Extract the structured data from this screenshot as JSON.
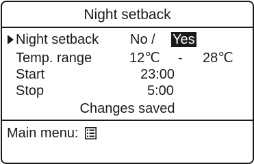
{
  "screen": {
    "title": "Night setback"
  },
  "settings": {
    "night_setback": {
      "label": "Night setback",
      "option_no": "No /",
      "option_yes": "Yes",
      "selected": "Yes"
    },
    "temp_range": {
      "label": "Temp. range",
      "low": "12℃",
      "separator": "-",
      "high": "28℃"
    },
    "start": {
      "label": "Start",
      "value": "23:00"
    },
    "stop": {
      "label": "Stop",
      "value": "5:00"
    }
  },
  "status": {
    "message": "Changes saved"
  },
  "footer": {
    "main_menu_label": "Main menu:",
    "main_menu_icon": "menu-list-icon"
  }
}
